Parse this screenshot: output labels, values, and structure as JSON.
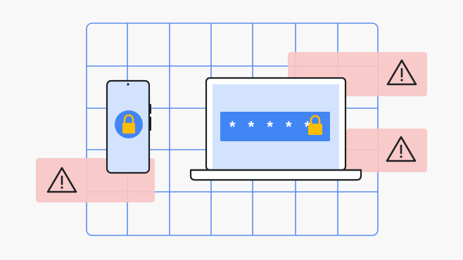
{
  "scene": {
    "background": "#f8f8f8",
    "grid_color": "#5b8def",
    "warning_bg": "#f7c6c5",
    "device_fill": "#d3e3fd",
    "device_stroke": "#202124",
    "accent_blue": "#4285f4",
    "lock_color": "#fbbc04"
  },
  "password_field": {
    "masked_text": "* * * * *",
    "icon": "lock-icon"
  },
  "phone": {
    "icon": "lock-icon"
  },
  "warnings": [
    {
      "icon": "warning-icon"
    },
    {
      "icon": "warning-icon"
    },
    {
      "icon": "warning-icon"
    }
  ]
}
